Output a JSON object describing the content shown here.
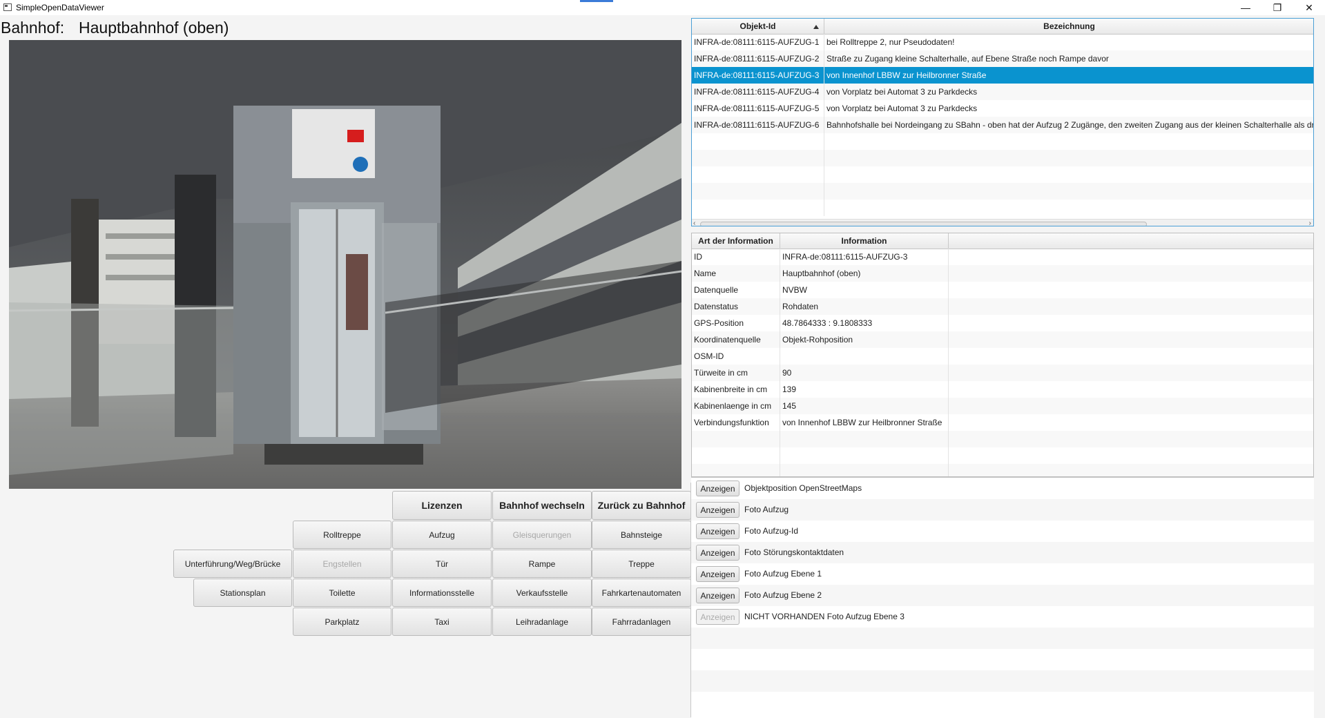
{
  "window": {
    "title": "SimpleOpenDataViewer",
    "minimize_icon": "minimize-icon",
    "restore_icon": "restore-icon",
    "close_icon": "close-icon"
  },
  "station": {
    "label": "Bahnhof:",
    "name": "Hauptbahnhof (oben)"
  },
  "buttons": {
    "lizenzen": "Lizenzen",
    "bahnhof_wechseln": "Bahnhof wechseln",
    "zurueck": "Zurück zu Bahnhof",
    "rolltreppe": "Rolltreppe",
    "aufzug": "Aufzug",
    "gleisquerungen": "Gleisquerungen",
    "bahnsteige": "Bahnsteige",
    "unterfuehrung": "Unterführung/Weg/Brücke",
    "engstellen": "Engstellen",
    "tuer": "Tür",
    "rampe": "Rampe",
    "treppe": "Treppe",
    "stationsplan": "Stationsplan",
    "toilette": "Toilette",
    "informationsstelle": "Informationsstelle",
    "verkaufsstelle": "Verkaufsstelle",
    "fahrkartenautomaten": "Fahrkartenautomaten",
    "parkplatz": "Parkplatz",
    "taxi": "Taxi",
    "leihradanlage": "Leihradanlage",
    "fahrradanlagen": "Fahrradanlagen"
  },
  "objects_table": {
    "headers": [
      "Objekt-Id",
      "Bezeichnung"
    ],
    "sort_icon": "sort-ascending-icon",
    "rows": [
      [
        "INFRA-de:08111:6115-AUFZUG-1",
        "bei Rolltreppe 2, nur Pseudodaten!"
      ],
      [
        "INFRA-de:08111:6115-AUFZUG-2",
        "Straße zu Zugang kleine Schalterhalle, auf Ebene Straße noch Rampe davor"
      ],
      [
        "INFRA-de:08111:6115-AUFZUG-3",
        "von Innenhof LBBW zur Heilbronner Straße"
      ],
      [
        "INFRA-de:08111:6115-AUFZUG-4",
        "von Vorplatz bei Automat 3 zu Parkdecks"
      ],
      [
        "INFRA-de:08111:6115-AUFZUG-5",
        "von Vorplatz bei Automat 3 zu Parkdecks"
      ],
      [
        "INFRA-de:08111:6115-AUFZUG-6",
        "Bahnhofshalle bei Nordeingang zu SBahn - oben hat der Aufzug 2 Zugänge, den zweiten Zugang aus der kleinen Schalterhalle als dri"
      ]
    ],
    "selected_index": 2
  },
  "info_table": {
    "headers": [
      "Art der Information",
      "Information"
    ],
    "rows": [
      [
        "ID",
        "INFRA-de:08111:6115-AUFZUG-3"
      ],
      [
        "Name",
        "Hauptbahnhof (oben)"
      ],
      [
        "Datenquelle",
        "NVBW"
      ],
      [
        "Datenstatus",
        "Rohdaten"
      ],
      [
        "GPS-Position",
        "48.7864333 : 9.1808333"
      ],
      [
        "Koordinatenquelle",
        "Objekt-Rohposition"
      ],
      [
        "OSM-ID",
        ""
      ],
      [
        "Türweite in cm",
        "90"
      ],
      [
        "Kabinenbreite in cm",
        "139"
      ],
      [
        "Kabinenlaenge in cm",
        "145"
      ],
      [
        "Verbindungsfunktion",
        "von Innenhof LBBW zur Heilbronner Straße"
      ]
    ]
  },
  "links": {
    "button_label": "Anzeigen",
    "items": [
      {
        "label": "Objektposition OpenStreetMaps",
        "enabled": true
      },
      {
        "label": "Foto Aufzug",
        "enabled": true
      },
      {
        "label": "Foto Aufzug-Id",
        "enabled": true
      },
      {
        "label": "Foto Störungskontaktdaten",
        "enabled": true
      },
      {
        "label": "Foto Aufzug Ebene 1",
        "enabled": true
      },
      {
        "label": "Foto Aufzug Ebene 2",
        "enabled": true
      },
      {
        "label": "NICHT VORHANDEN Foto Aufzug Ebene 3",
        "enabled": false
      }
    ]
  }
}
